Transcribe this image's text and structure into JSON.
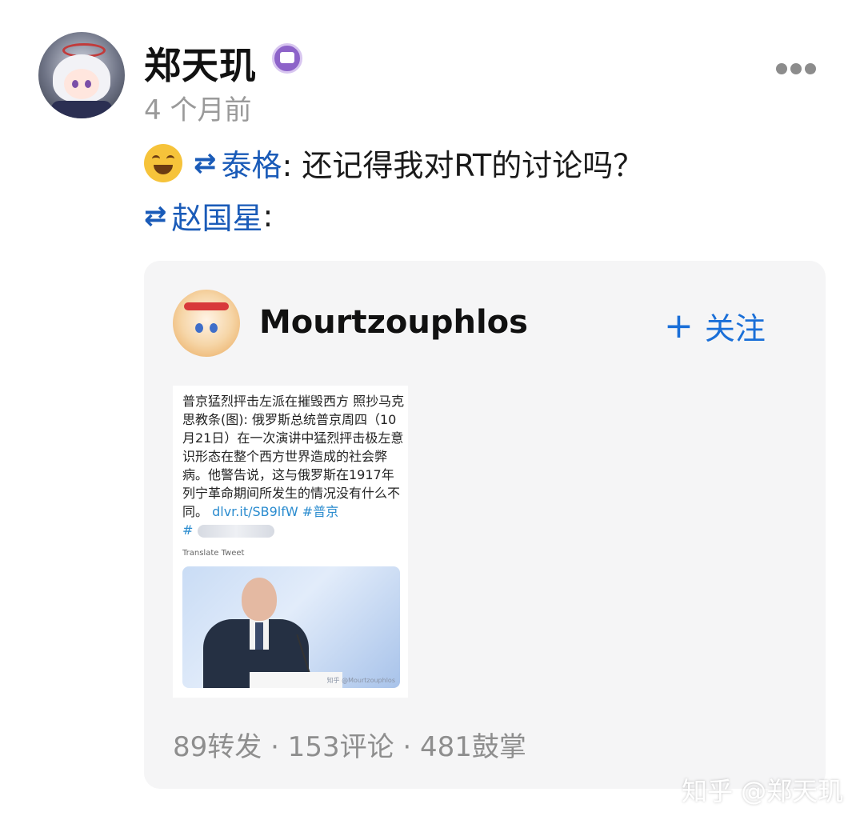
{
  "post": {
    "author": "郑天玑",
    "time": "4 个月前",
    "line1": {
      "rt_icon": "⇄",
      "repost_user": "泰格",
      "text": ": 还记得我对RT的讨论吗？"
    },
    "line2": {
      "rt_icon": "⇄",
      "repost_user": "赵国星",
      "text": ":"
    }
  },
  "card": {
    "author": "Mourtzouphlos",
    "follow_plus": "+",
    "follow_label": "关注",
    "image": {
      "text_main": "普京猛烈抨击左派在摧毁西方 照抄马克思教条(图): 俄罗斯总统普京周四（10月21日）在一次演讲中猛烈抨击极左意识形态在整个西方世界造成的社会弊病。他警告说，这与俄罗斯在1917年列宁革命期间所发生的情况没有什么不同。",
      "link": "dlvr.it/SB9lfW",
      "hashtag": "#普京",
      "hash2": "#",
      "translate": "Translate Tweet",
      "photo_watermark": "知乎 @Mourtzouphlos"
    },
    "stats": "89转发 · 153评论 · 481鼓掌"
  },
  "watermark": "知乎 @郑天玑",
  "icons": {
    "more": "more-dots-icon",
    "repost": "repost-icon",
    "badge": "verified-badge-icon",
    "emoji": "laughing-emoji-icon"
  },
  "colors": {
    "link": "#1a5bb8",
    "follow": "#1a6fd8",
    "muted": "#9a9a9a",
    "card_bg": "#f5f5f6"
  }
}
